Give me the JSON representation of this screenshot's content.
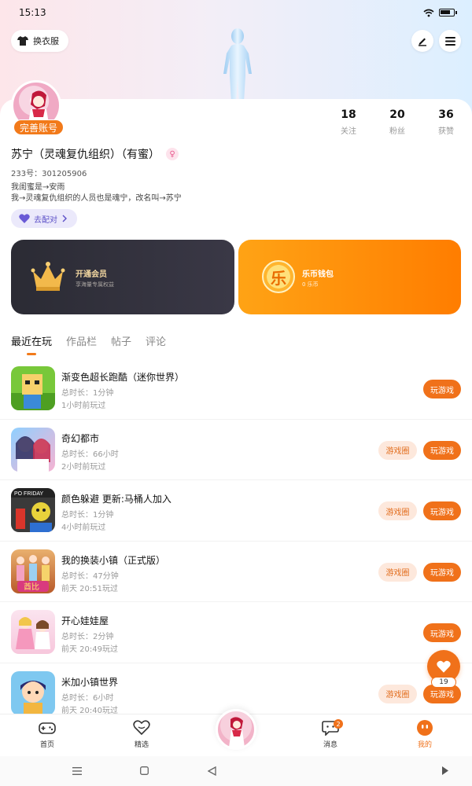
{
  "status_bar": {
    "time": "15:13"
  },
  "header": {
    "outfit_label": "换衣服",
    "edit_icon": "pen-icon",
    "menu_icon": "hamburger-icon"
  },
  "profile": {
    "badge": "完善账号",
    "nickname": "苏宁（灵魂复仇组织）（有蜜）",
    "gender_symbol": "♀",
    "uid": "233号：301205906",
    "bio": [
      "我闺蜜是→安雨",
      "我→灵魂复仇组织的人员也是魂宁，改名叫→苏宁"
    ],
    "pair_label": "去配对",
    "stats": [
      {
        "num": "18",
        "label": "关注"
      },
      {
        "num": "20",
        "label": "粉丝"
      },
      {
        "num": "36",
        "label": "获赞"
      }
    ]
  },
  "cards": {
    "vip": {
      "title": "开通会员",
      "subtitle": "享海量专属权益"
    },
    "coin": {
      "title": "乐币钱包",
      "subtitle": "0 乐币",
      "coin_char": "乐"
    }
  },
  "tabs": [
    "最近在玩",
    "作品栏",
    "帖子",
    "评论"
  ],
  "games": [
    {
      "title": "渐变色超长跑酷（迷你世界）",
      "duration": "总时长：1分钟",
      "last_played": "1小时前玩过",
      "circle": "",
      "play": "玩游戏"
    },
    {
      "title": "奇幻都市",
      "duration": "总时长：66小时",
      "last_played": "2小时前玩过",
      "circle": "游戏圈",
      "play": "玩游戏"
    },
    {
      "title": "颜色躲避 更新:马桶人加入",
      "duration": "总时长：1分钟",
      "last_played": "4小时前玩过",
      "circle": "游戏圈",
      "play": "玩游戏"
    },
    {
      "title": "我的换装小镇（正式版）",
      "duration": "总时长：47分钟",
      "last_played": "前天 20:51玩过",
      "circle": "游戏圈",
      "play": "玩游戏"
    },
    {
      "title": "开心娃娃屋",
      "duration": "总时长：2分钟",
      "last_played": "前天 20:49玩过",
      "circle": "",
      "play": "玩游戏"
    },
    {
      "title": "米加小镇世界",
      "duration": "总时长：6小时",
      "last_played": "前天 20:40玩过",
      "circle": "游戏圈",
      "play": "玩游戏"
    }
  ],
  "icon_texts": {
    "color_dodge": "PO FRIDAY",
    "dressup": "酋比"
  },
  "float_like": {
    "count": "19"
  },
  "bottom_nav": [
    {
      "label": "首页"
    },
    {
      "label": "精选"
    },
    {
      "label": "消息",
      "badge": "2"
    },
    {
      "label": "我的"
    }
  ],
  "colors": {
    "accent": "#f0711a",
    "vip_dark": "#2b2b34",
    "coin_orange": "#ff8a00"
  }
}
